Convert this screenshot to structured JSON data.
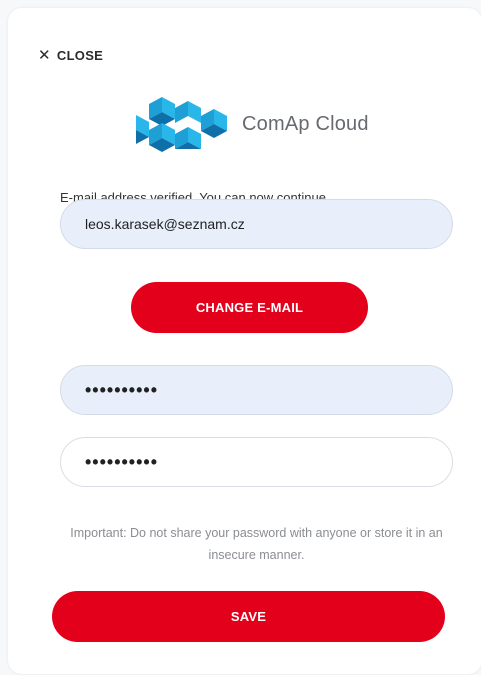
{
  "dialog": {
    "close_label": "CLOSE",
    "close_icon": "close-icon",
    "logo_text": "ComAp Cloud",
    "brand_colors": {
      "light": "#29b6e8",
      "dark": "#0f6fa8",
      "accent": "#e3001b"
    },
    "verify_message": "E-mail address verified. You can now continue.",
    "email_value": "leos.karasek@seznam.cz",
    "change_email_label": "CHANGE E-MAIL",
    "password_value": "••••••••••",
    "confirm_password_value": "••••••••••",
    "hint": "Important: Do not share your password with anyone or store it in an insecure manner.",
    "save_label": "SAVE"
  }
}
